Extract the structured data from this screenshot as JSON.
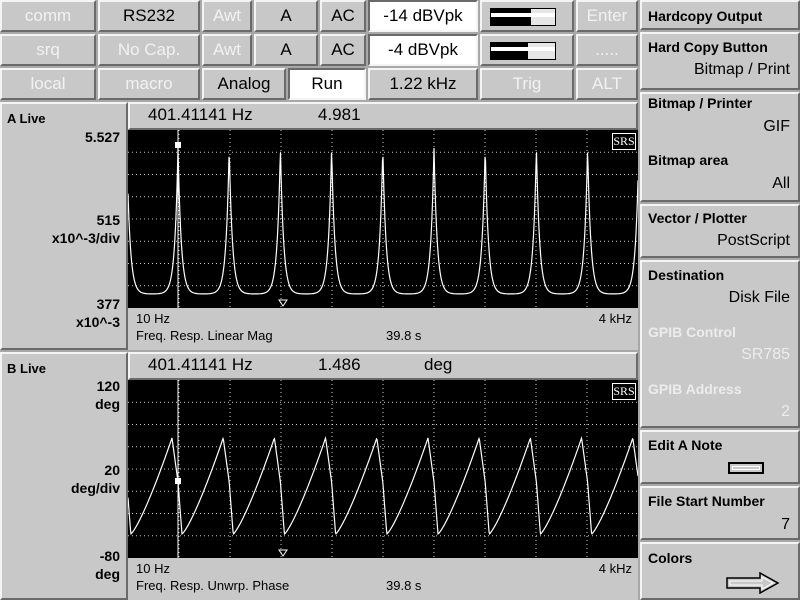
{
  "top_buttons": {
    "row1": [
      "comm",
      "RS232",
      "Awt",
      "A",
      "AC",
      "-14 dBVpk",
      "Enter"
    ],
    "row2": [
      "srq",
      "No Cap.",
      "Awt",
      "A",
      "AC",
      "-4 dBVpk",
      "....."
    ],
    "row3": [
      "local",
      "macro",
      "Analog",
      "Run",
      "1.22 kHz",
      "Trig",
      "ALT"
    ]
  },
  "meters": {
    "ch1_level": 0.62,
    "ch2_level": 0.58
  },
  "sidebar": {
    "title": "Hardcopy Output",
    "hardcopy_button": {
      "label": "Hard Copy Button",
      "value": "Bitmap / Print"
    },
    "bitmap_printer": {
      "label": "Bitmap / Printer",
      "value": "GIF"
    },
    "bitmap_area": {
      "label": "Bitmap area",
      "value": "All"
    },
    "vector_plotter": {
      "label": "Vector / Plotter",
      "value": "PostScript"
    },
    "destination": {
      "label": "Destination",
      "value": "Disk File"
    },
    "gpib_control": {
      "label": "GPIB Control",
      "value": "SR785"
    },
    "gpib_address": {
      "label": "GPIB Address",
      "value": "2"
    },
    "edit_note": {
      "label": "Edit A Note"
    },
    "file_start": {
      "label": "File Start Number",
      "value": "7"
    },
    "colors": {
      "label": "Colors"
    }
  },
  "display_a": {
    "name": "A Live",
    "marker_freq": "401.41141 Hz",
    "marker_value": "4.981",
    "marker_unit": "",
    "y_top": "5.527",
    "y_div_value": "515",
    "y_div_unit": "x10^-3/div",
    "y_bottom": "377",
    "y_bottom_unit": "x10^-3",
    "x_start": "10 Hz",
    "x_end": "4 kHz",
    "measurement": "Freq. Resp. Linear Mag",
    "time": "39.8 s",
    "logo": "SRS"
  },
  "display_b": {
    "name": "B Live",
    "marker_freq": "401.41141 Hz",
    "marker_value": "1.486",
    "marker_unit": "deg",
    "y_top": "120",
    "y_top_unit": "deg",
    "y_div_value": "20",
    "y_div_unit": "deg/div",
    "y_bottom": "-80",
    "y_bottom_unit": "deg",
    "x_start": "10 Hz",
    "x_end": "4 kHz",
    "measurement": "Freq. Resp. Unwrp. Phase",
    "time": "39.8 s",
    "logo": "SRS"
  }
}
